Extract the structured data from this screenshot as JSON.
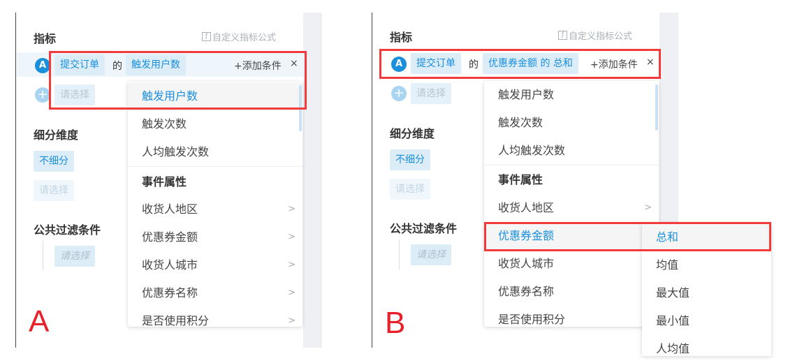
{
  "panels": [
    {
      "letter": "A",
      "metrics_title": "指标",
      "custom_formula": "自定义指标公式",
      "metric_badge": "A",
      "event_chip": "提交订单",
      "of": "的",
      "measure_chip": "触发用户数",
      "add_condition": "+添加条件",
      "remove": "×",
      "select_placeholder": "请选择",
      "breakdown_title": "细分维度",
      "no_breakdown": "不细分",
      "breakdown_placeholder": "请选择",
      "filter_title": "公共过滤条件",
      "filter_placeholder": "请选择",
      "dropdown": {
        "items": [
          "触发用户数",
          "触发次数",
          "人均触发次数"
        ],
        "group": "事件属性",
        "props": [
          "收货人地区",
          "优惠券金额",
          "收货人城市",
          "优惠券名称",
          "是否使用积分"
        ],
        "selected": "触发用户数"
      }
    },
    {
      "letter": "B",
      "metrics_title": "指标",
      "custom_formula": "自定义指标公式",
      "metric_badge": "A",
      "event_chip": "提交订单",
      "of": "的",
      "measure_chip": "优惠券金额 的 总和",
      "add_condition": "+添加条件",
      "remove": "×",
      "select_placeholder": "请选择",
      "breakdown_title": "细分维度",
      "no_breakdown": "不细分",
      "breakdown_placeholder": "请选择",
      "filter_title": "公共过滤条件",
      "filter_placeholder": "请选择",
      "dropdown": {
        "items": [
          "触发用户数",
          "触发次数",
          "人均触发次数"
        ],
        "group": "事件属性",
        "props": [
          "收货人地区",
          "优惠券金额",
          "收货人城市",
          "优惠券名称",
          "是否使用积分"
        ],
        "selected": "优惠券金额"
      },
      "submenu": {
        "items": [
          "总和",
          "均值",
          "最大值",
          "最小值",
          "人均值"
        ],
        "selected": "总和"
      }
    }
  ]
}
